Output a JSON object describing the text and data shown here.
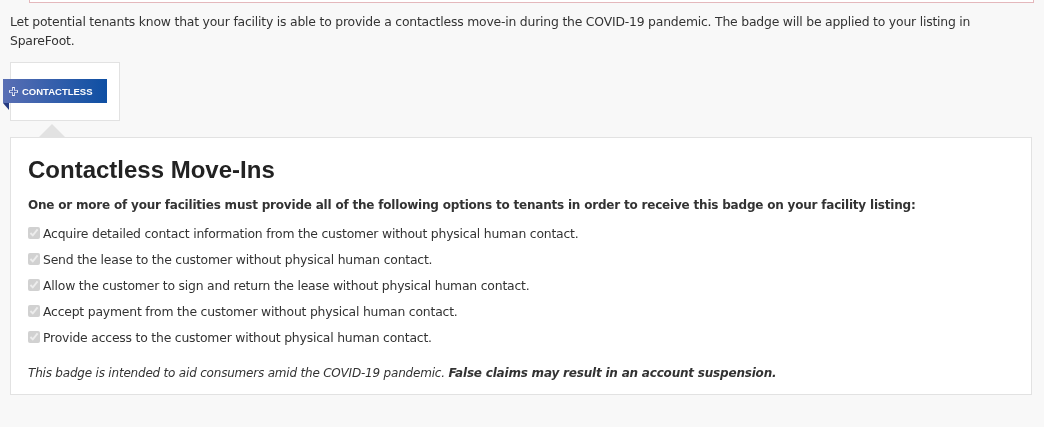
{
  "intro": "Let potential tenants know that your facility is able to provide a contactless move-in during the COVID-19 pandemic. The badge will be applied to your listing in SpareFoot.",
  "badge": {
    "label": "CONTACTLESS"
  },
  "card": {
    "title": "Contactless Move-Ins",
    "requirement": "One or more of your facilities must provide all of the following options to tenants in order to receive this badge on your facility listing:",
    "options": [
      {
        "label": "Acquire detailed contact information from the customer without physical human contact.",
        "checked": true
      },
      {
        "label": "Send the lease to the customer without physical human contact.",
        "checked": true
      },
      {
        "label": "Allow the customer to sign and return the lease without physical human contact.",
        "checked": true
      },
      {
        "label": "Accept payment from the customer without physical human contact.",
        "checked": true
      },
      {
        "label": "Provide access to the customer without physical human contact.",
        "checked": true
      }
    ],
    "note": "*This badge is intended to aid consumers amid the COVID-19 pandemic.* **False claims may result in an account suspension.**"
  }
}
